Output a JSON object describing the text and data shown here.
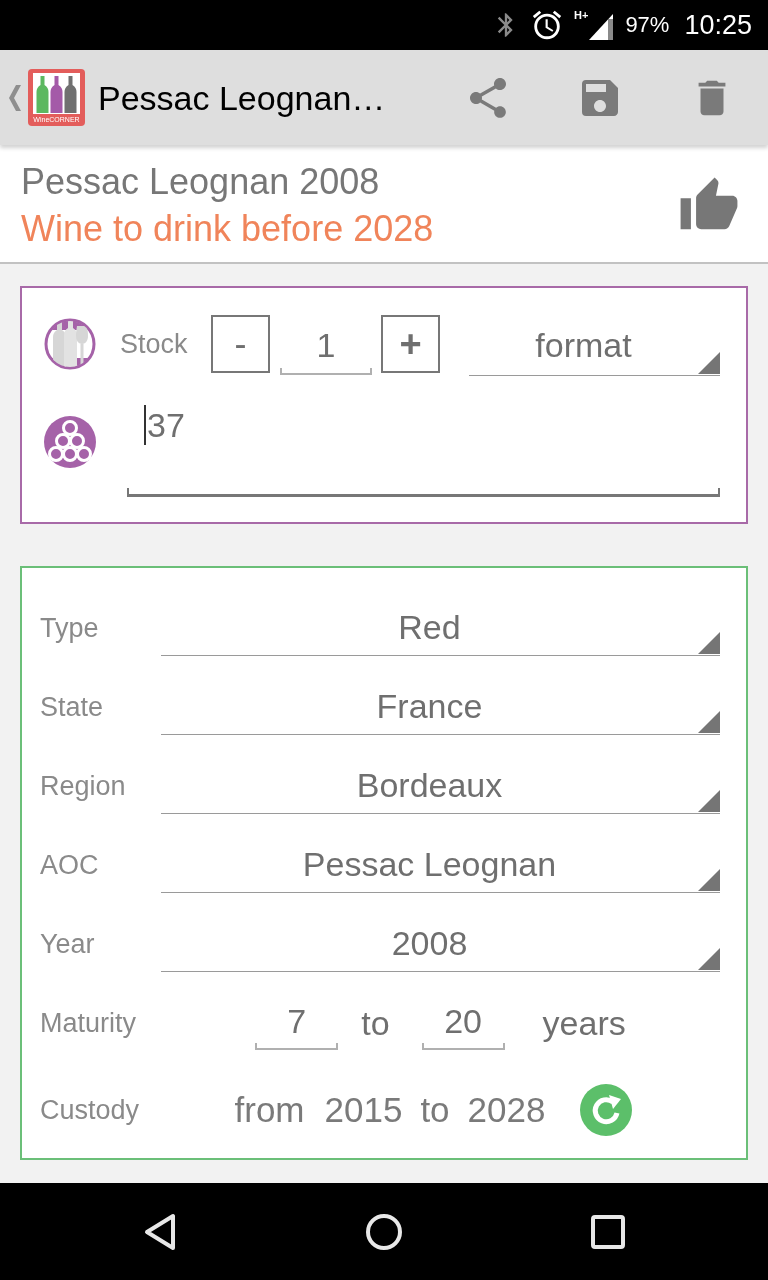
{
  "status_bar": {
    "network": "H+",
    "battery": "97%",
    "time": "10:25"
  },
  "toolbar": {
    "logo_text": "WineCORNER",
    "title": "Pessac Leognan…"
  },
  "header": {
    "name": "Pessac Leognan 2008",
    "drink_advice": "Wine to drink before 2028"
  },
  "stock_card": {
    "label": "Stock",
    "decrement": "-",
    "quantity": "1",
    "increment": "+",
    "format": "format",
    "location": {
      "value": "37",
      "focused": true
    }
  },
  "details_card": {
    "fields": [
      {
        "label": "Type",
        "value": "Red"
      },
      {
        "label": "State",
        "value": "France"
      },
      {
        "label": "Region",
        "value": "Bordeaux"
      },
      {
        "label": "AOC",
        "value": "Pessac Leognan"
      },
      {
        "label": "Year",
        "value": "2008"
      }
    ],
    "maturity": {
      "label": "Maturity",
      "from": "7",
      "joiner": "to",
      "to": "20",
      "unit": "years"
    },
    "custody": {
      "label": "Custody",
      "prefix": "from",
      "from": "2015",
      "joiner": "to",
      "to": "2028"
    }
  }
}
